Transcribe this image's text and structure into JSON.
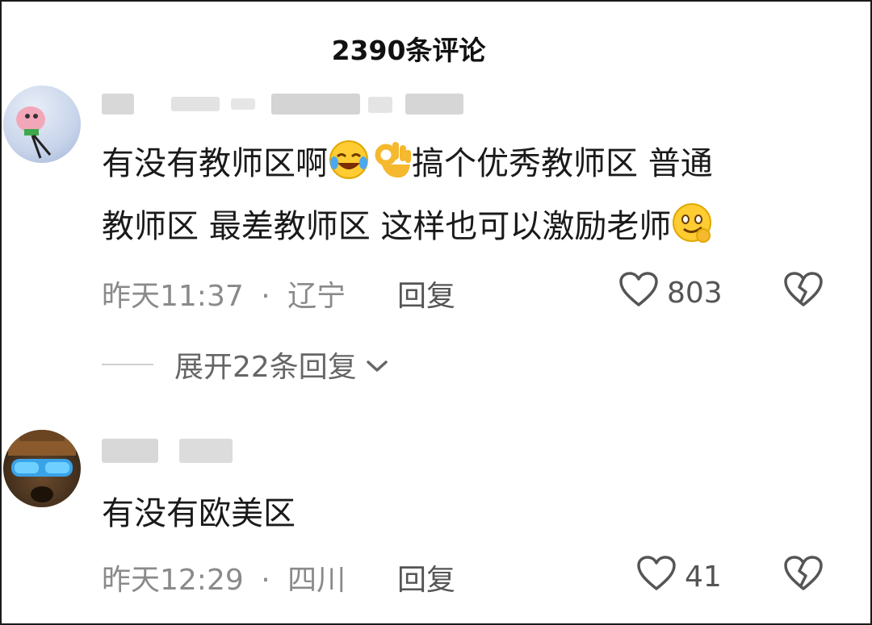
{
  "header": {
    "title": "2390条评论"
  },
  "comments": [
    {
      "text_line1": "有没有教师区啊",
      "text_mid": "搞个优秀教师区 普通",
      "text_line2": "教师区 最差教师区 这样也可以激励老师",
      "time": "昨天11:37",
      "sep": "·",
      "location": "辽宁",
      "reply_label": "回复",
      "likes": "803"
    },
    {
      "text": "有没有欧美区",
      "time": "昨天12:29",
      "sep": "·",
      "location": "四川",
      "reply_label": "回复",
      "likes": "41"
    }
  ],
  "expand_replies": {
    "label": "展开22条回复"
  },
  "icons": {
    "like": "heart-outline-icon",
    "dislike": "broken-heart-icon",
    "expand": "chevron-down-icon",
    "emoji_laugh": "laughing-tears-emoji",
    "emoji_ok": "ok-hand-emoji",
    "emoji_smirk": "smirk-emoji"
  }
}
